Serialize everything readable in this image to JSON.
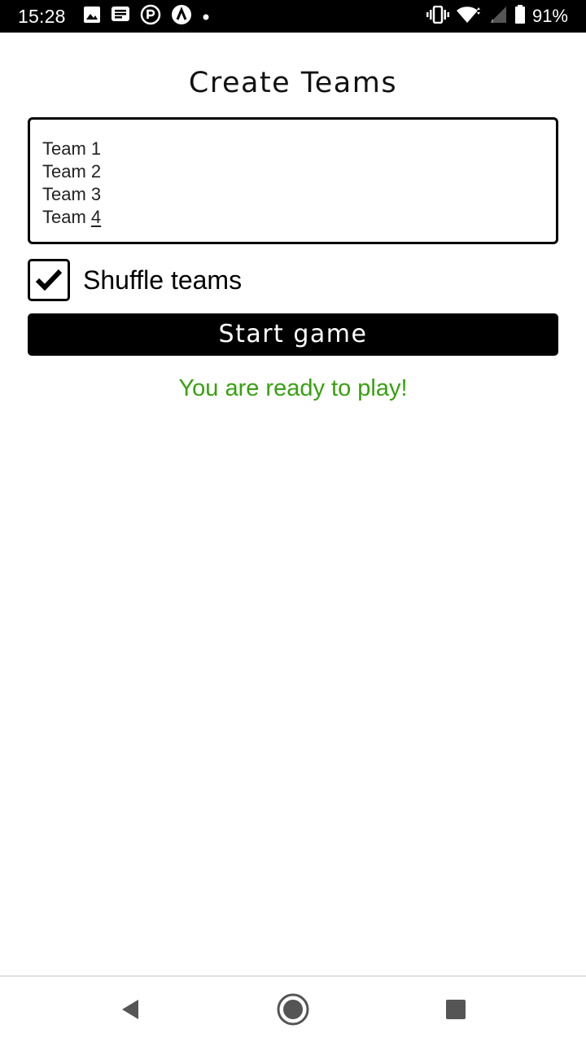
{
  "status_bar": {
    "time": "15:28",
    "battery": "91%",
    "left_icons": [
      "image-icon",
      "message-icon",
      "r-circle-icon",
      "a-circle-icon",
      "dot-icon"
    ],
    "right_icons": [
      "vibrate-icon",
      "wifi-icon",
      "signal-icon",
      "battery-icon"
    ]
  },
  "page": {
    "title": "Create Teams"
  },
  "teams_input": {
    "lines": [
      {
        "base": "Team 1",
        "underlined": ""
      },
      {
        "base": "Team 2",
        "underlined": ""
      },
      {
        "base": "Team 3",
        "underlined": ""
      },
      {
        "base": "Team ",
        "underlined": "4"
      }
    ]
  },
  "shuffle": {
    "label": "Shuffle teams",
    "checked": true
  },
  "start_button": {
    "label": "Start game"
  },
  "message": {
    "text": "You are ready to play!",
    "color": "#37a10f"
  },
  "nav_bar": {
    "icons": [
      "back-icon",
      "home-icon",
      "recents-icon"
    ]
  }
}
